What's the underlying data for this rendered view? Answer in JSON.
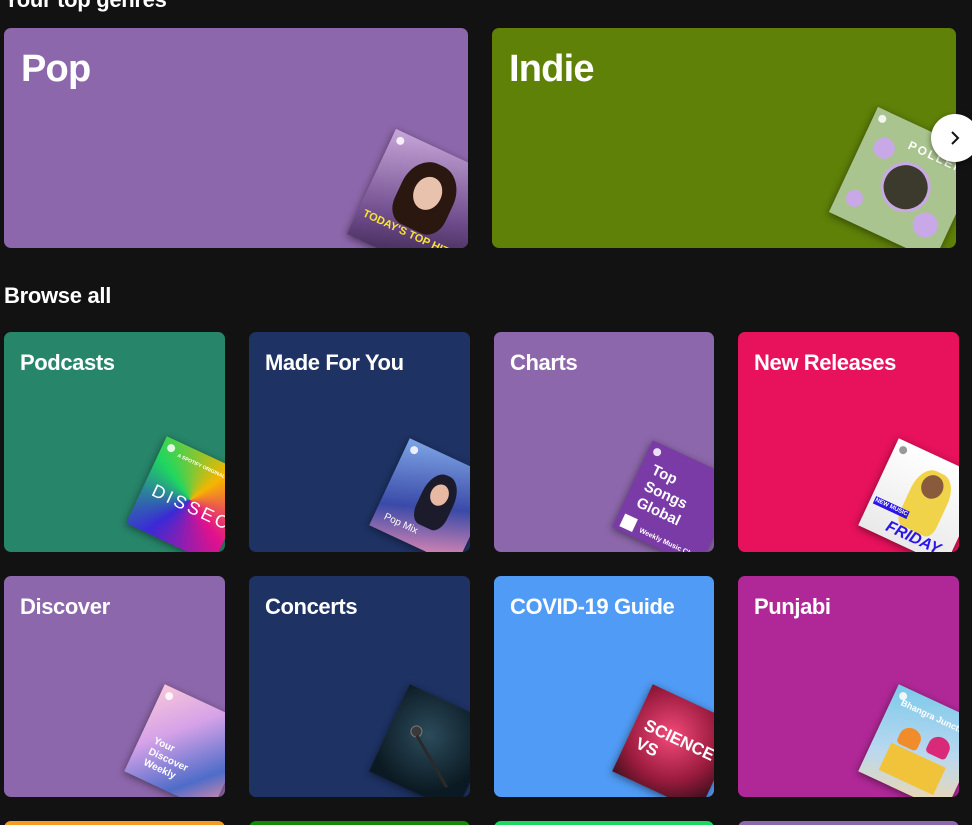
{
  "top_genres": {
    "title": "Your top genres",
    "cards": [
      {
        "label": "Pop",
        "color": "#8d67ab",
        "art_caption": "TODAY'S TOP HITS"
      },
      {
        "label": "Indie",
        "color": "#5f8108",
        "art_caption": "POLLEN"
      }
    ],
    "next_icon": "chevron-right-icon"
  },
  "browse": {
    "title": "Browse all",
    "cards": [
      {
        "label": "Podcasts",
        "color": "#27856a",
        "art_caption": "DISSECT",
        "art_sub": "A SPOTIFY ORIGINAL"
      },
      {
        "label": "Made For You",
        "color": "#1e3264",
        "art_caption": "Pop Mix"
      },
      {
        "label": "Charts",
        "color": "#8d67ab",
        "art_caption": "Top Songs Global",
        "art_sub": "Weekly Music Charts"
      },
      {
        "label": "New Releases",
        "color": "#e8115b",
        "art_caption": "FRIDAY",
        "art_sub": "NEW MUSIC"
      },
      {
        "label": "Discover",
        "color": "#8d67ab",
        "art_caption": "Your Discover Weekly"
      },
      {
        "label": "Concerts",
        "color": "#1e3264",
        "art_caption": ""
      },
      {
        "label": "COVID-19 Guide",
        "color": "#509bf5",
        "art_caption": "SCIENCE VS"
      },
      {
        "label": "Punjabi",
        "color": "#b02897",
        "art_caption": "Bhangra Junction"
      }
    ]
  },
  "bottom_row_colors": [
    "#f59b23",
    "#148a08",
    "#1ed760",
    "#8d67ab"
  ]
}
